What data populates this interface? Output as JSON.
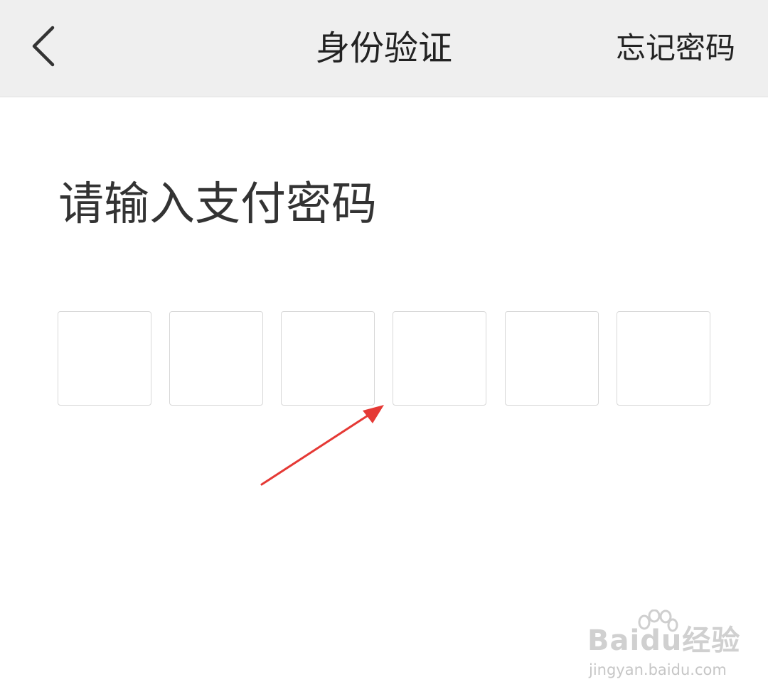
{
  "header": {
    "back_icon": "chevron-left-icon",
    "title": "身份验证",
    "forgot_password_label": "忘记密码"
  },
  "main": {
    "prompt": "请输入支付密码",
    "pin_length": 6
  },
  "annotation": {
    "arrow_color": "#e53935"
  },
  "watermark": {
    "brand_text": "Baidu经验",
    "url": "jingyan.baidu.com"
  },
  "colors": {
    "header_bg": "#efefef",
    "page_bg": "#ffffff",
    "box_border": "#d8d8d8",
    "text_primary": "#222222"
  }
}
